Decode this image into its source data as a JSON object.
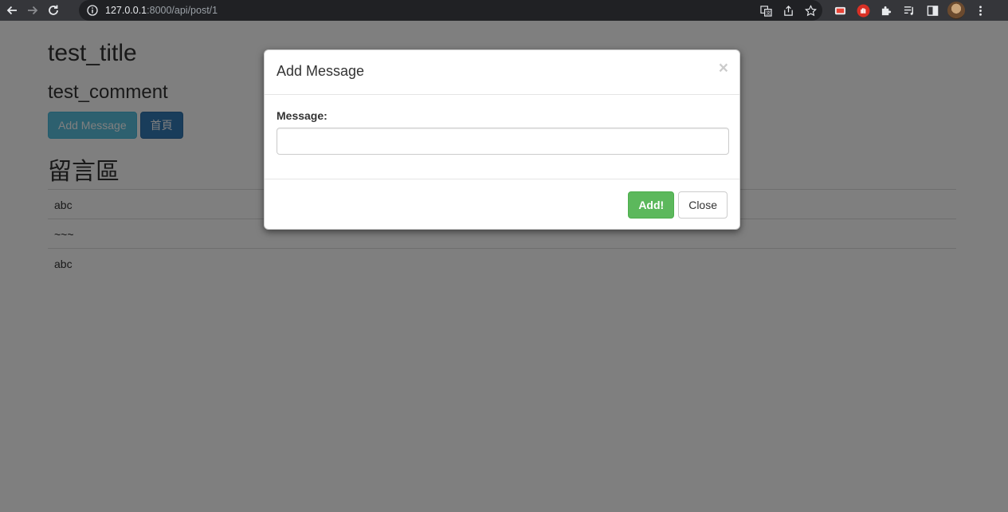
{
  "browser": {
    "url_host": "127.0.0.1",
    "url_path": ":8000/api/post/1",
    "icons": {
      "back": "arrow-left-icon",
      "forward": "arrow-right-icon",
      "reload": "reload-icon",
      "site_info": "info-icon",
      "translate": "translate-icon",
      "share": "share-icon",
      "bookmark": "star-icon"
    },
    "extensions": [
      "extension-icon-1",
      "stop-hand-icon",
      "puzzle-icon",
      "playlist-icon",
      "sidebar-icon",
      "avatar",
      "kebab-menu-icon"
    ]
  },
  "page": {
    "title": "test_title",
    "subtitle": "test_comment",
    "buttons": {
      "add_message": "Add Message",
      "home": "首頁"
    },
    "section_title": "留言區",
    "messages": [
      "abc",
      "~~~",
      "abc"
    ]
  },
  "modal": {
    "title": "Add Message",
    "close_glyph": "×",
    "label": "Message:",
    "input_value": "",
    "input_placeholder": "",
    "add_button": "Add!",
    "close_button": "Close"
  },
  "colors": {
    "btn_info": "#5bc0de",
    "btn_primary": "#337ab7",
    "btn_success": "#5cb85c",
    "chrome_bg": "#35363a"
  }
}
